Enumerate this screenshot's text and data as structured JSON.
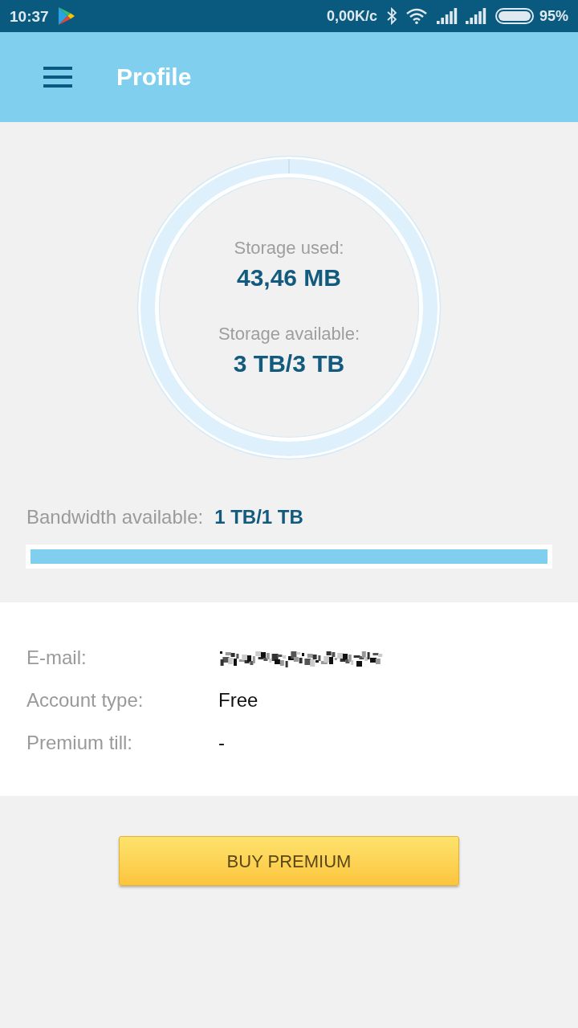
{
  "status_bar": {
    "time": "10:37",
    "network_speed": "0,00K/c",
    "battery": "95%"
  },
  "header": {
    "title": "Profile"
  },
  "storage": {
    "used_label": "Storage used:",
    "used_value": "43,46 MB",
    "available_label": "Storage available:",
    "available_value": "3 TB/3 TB"
  },
  "bandwidth": {
    "label": "Bandwidth available:",
    "value": "1 TB/1 TB",
    "level": 1
  },
  "account": {
    "rows": [
      {
        "label": "E-mail:",
        "kind": "obscured"
      },
      {
        "label": "Account type:",
        "kind": "text",
        "value": "Free"
      },
      {
        "label": "Premium till:",
        "kind": "text",
        "value": "-"
      }
    ]
  },
  "buttons": [
    {
      "label": "BUY PREMIUM"
    }
  ]
}
